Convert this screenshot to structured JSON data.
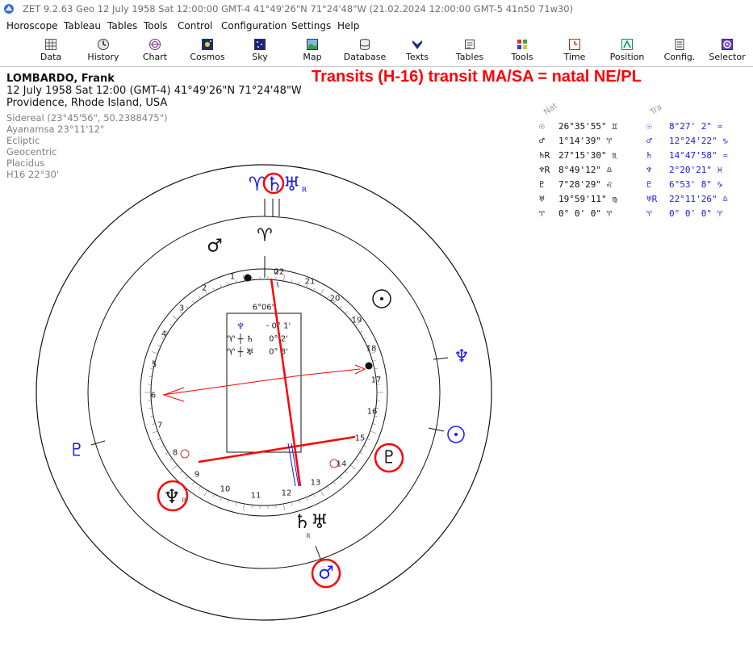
{
  "window": {
    "title": "ZET 9.2.63 Geo    12 July 1958  Sat  12:00:00 GMT-4 41°49'26\"N  71°24'48\"W  (21.02.2024  12:00:00 GMT-5 41n50 71w30)"
  },
  "menu": [
    "Horoscope",
    "Tableau",
    "Tables",
    "Tools",
    "Control",
    "Configuration",
    "Settings",
    "Help"
  ],
  "toolbar": [
    {
      "label": "Data",
      "icon": "data-icon"
    },
    {
      "label": "History",
      "icon": "history-icon"
    },
    {
      "label": "Chart",
      "icon": "chart-icon"
    },
    {
      "label": "Cosmos",
      "icon": "cosmos-icon"
    },
    {
      "label": "Sky",
      "icon": "sky-icon"
    },
    {
      "label": "Map",
      "icon": "map-icon"
    },
    {
      "label": "Database",
      "icon": "database-icon"
    },
    {
      "label": "Texts",
      "icon": "texts-icon"
    },
    {
      "label": "Tables",
      "icon": "tables-icon"
    },
    {
      "label": "Tools",
      "icon": "tools-icon"
    },
    {
      "label": "Time",
      "icon": "time-icon"
    },
    {
      "label": "Position",
      "icon": "position-icon"
    },
    {
      "label": "Config.",
      "icon": "config-icon"
    },
    {
      "label": "Selector",
      "icon": "selector-icon"
    }
  ],
  "info": {
    "name": "LOMBARDO, Frank",
    "date_line": "12 July 1958  Sat  12:00 (GMT-4) 41°49'26\"N  71°24'48\"W",
    "place": "Providence, Rhode Island, USA",
    "settings": [
      "Sidereal (23°45'56\", 50.2388475\")",
      "Ayanamsa 23°11'12\"",
      "Ecliptic",
      "Geocentric",
      "Placidus",
      "H16  22°30'"
    ]
  },
  "headline": "Transits (H-16) transit MA/SA = natal NE/PL",
  "table": {
    "nat_header": "Nat",
    "tra_header": "Tra",
    "rows": [
      {
        "nat_glyph": "☉",
        "nat_pos": "26°35'55\" ♊",
        "tra_glyph": "☉",
        "tra_pos": "8°27' 2\" ♒"
      },
      {
        "nat_glyph": "♂",
        "nat_pos": "1°14'39\" ♈",
        "tra_glyph": "♂",
        "tra_pos": "12°24'22\" ♑"
      },
      {
        "nat_glyph": "♄R",
        "nat_pos": "27°15'30\" ♏",
        "tra_glyph": "♄",
        "tra_pos": "14°47'58\" ♒"
      },
      {
        "nat_glyph": "♆R",
        "nat_pos": "8°49'12\" ♎",
        "tra_glyph": "♆",
        "tra_pos": "2°20'21\" ♓"
      },
      {
        "nat_glyph": "♇",
        "nat_pos": "7°28'29\" ♌",
        "tra_glyph": "♇",
        "tra_pos": "6°53' 8\" ♑"
      },
      {
        "nat_glyph": "♅",
        "nat_pos": "19°59'11\" ♍",
        "tra_glyph": "♅R",
        "tra_pos": "22°11'26\" ♎"
      },
      {
        "nat_glyph": "♈",
        "nat_pos": "0° 0' 0\" ♈",
        "tra_glyph": "♈",
        "tra_pos": "0° 0' 0\" ♈"
      }
    ]
  },
  "wheel": {
    "top_marker": "♈",
    "mid_degree": "6°06'",
    "house_numbers": [
      "0",
      "1",
      "2",
      "3",
      "4",
      "5",
      "6",
      "7",
      "8",
      "9",
      "10",
      "11",
      "12",
      "13",
      "14",
      "15",
      "16",
      "17",
      "18",
      "19",
      "20",
      "21",
      "22"
    ],
    "aspect_box": [
      {
        "glyph": "♆",
        "value": "- 0° 1'"
      },
      {
        "glyph": "♈ ┼ ♄",
        "value": "0° 2'"
      },
      {
        "glyph": "♈ ┼ ♅",
        "value": "0° 8'"
      }
    ],
    "planets": {
      "transit_mars_saturn_uranus": "♈♄♅",
      "transit_uranus_r": "R",
      "natal_mars": "♂",
      "natal_sun": "☉",
      "natal_pluto": "♇",
      "natal_neptune": "♆",
      "natal_neptune_r": "R",
      "natal_saturn_uranus": "♄♅",
      "natal_saturn_r": "R",
      "transit_neptune": "♆",
      "transit_sun": "☉",
      "transit_pluto": "♇",
      "transit_mars": "♂"
    },
    "colors": {
      "natal": "#111111",
      "transit": "#1a1aee",
      "highlight": "#ff0000"
    }
  }
}
